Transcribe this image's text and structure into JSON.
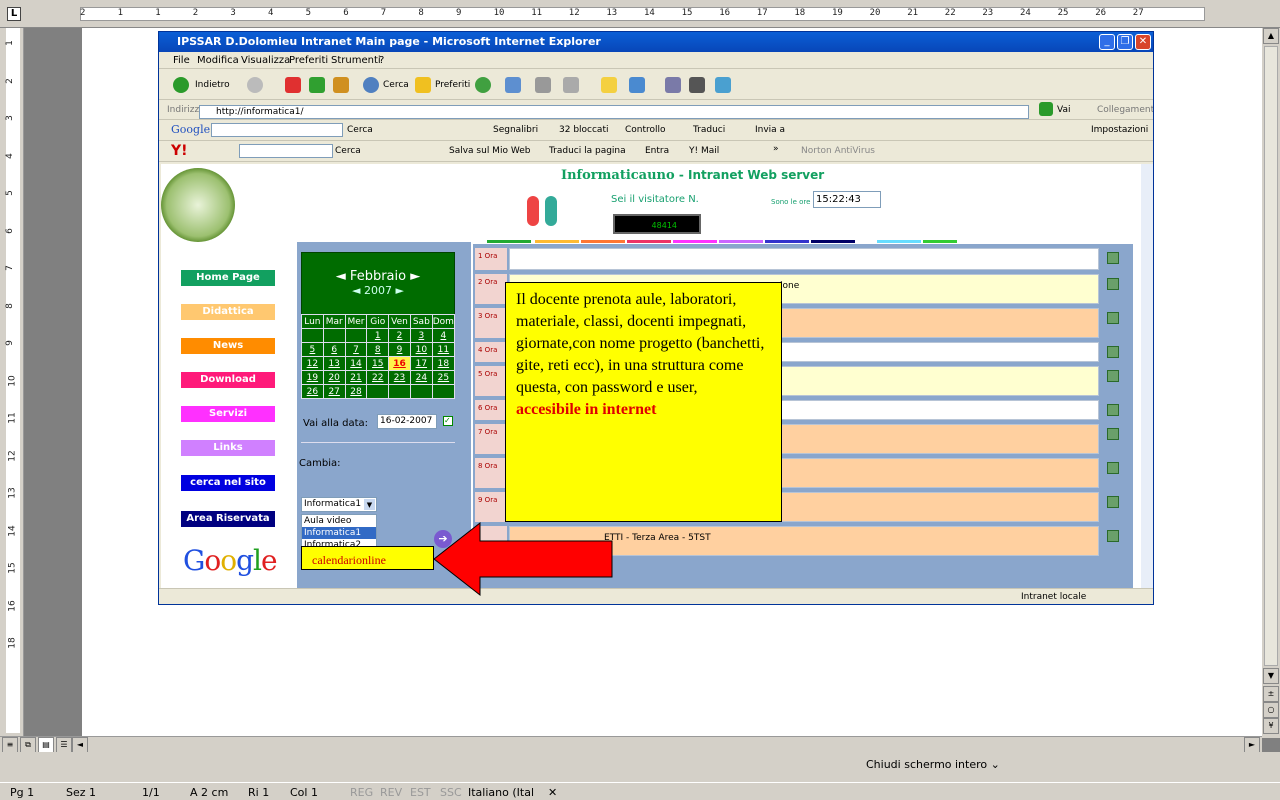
{
  "word": {
    "ruler_corner": "L",
    "ruler_ticks": [
      "2",
      "1",
      "1",
      "2",
      "3",
      "4",
      "5",
      "6",
      "7",
      "8",
      "9",
      "10",
      "11",
      "12",
      "13",
      "14",
      "15",
      "16",
      "17",
      "18",
      "19",
      "20",
      "21",
      "22",
      "23",
      "24",
      "25",
      "26",
      "27"
    ],
    "vruler_ticks": [
      "1",
      "2",
      "3",
      "4",
      "5",
      "6",
      "7",
      "8",
      "9",
      "10",
      "11",
      "12",
      "13",
      "14",
      "15",
      "16",
      "18"
    ],
    "close_fullscreen": "Chiudi schermo intero",
    "status": {
      "pg": "Pg 1",
      "sez": "Sez 1",
      "pages": "1/1",
      "at": "A 2 cm",
      "ri": "Ri 1",
      "col": "Col 1",
      "reg": "REG",
      "rev": "REV",
      "est": "EST",
      "ssc": "SSC",
      "lang": "Italiano (Ital"
    }
  },
  "ie": {
    "title": "IPSSAR D.Dolomieu Intranet Main page - Microsoft Internet Explorer",
    "menu": [
      "File",
      "Modifica",
      "Visualizza",
      "Preferiti",
      "Strumenti",
      "?"
    ],
    "toolbar": {
      "back": "Indietro",
      "search": "Cerca",
      "favorites": "Preferiti"
    },
    "address_label": "Indirizzo",
    "address": "http://informatica1/",
    "go": "Vai",
    "links": "Collegamenti",
    "google_bar": {
      "logo": "Google",
      "search": "Cerca",
      "bookmarks": "Segnalibri",
      "blocked": "32 bloccati",
      "check": "Controllo",
      "translate": "Traduci",
      "send": "Invia a",
      "settings": "Impostazioni"
    },
    "yahoo_bar": {
      "logo": "Y!",
      "search": "Cerca",
      "save": "Salva sul Mio Web",
      "translate": "Traduci la pagina",
      "enter": "Entra",
      "mail": "Y! Mail",
      "norton": "Norton AntiVirus",
      "more": "»"
    },
    "statusbar_zone": "Intranet locale"
  },
  "site": {
    "title": "Informaticauno",
    "subtitle": " - Intranet Web server",
    "visitor_label": "Sei il visitatore N.",
    "counter": "48414",
    "time_label": "Sono le ore",
    "time": "15:22:43",
    "nav": [
      "Home Page",
      "Didattica",
      "News",
      "Download",
      "Servizi",
      "Links",
      "cerca nel sito",
      "Area Riservata"
    ],
    "nav_colors": [
      "#12a060",
      "#ffc870",
      "#ff8c00",
      "#ff1a7a",
      "#ff30ff",
      "#d080ff",
      "#0000e0",
      "#000080"
    ],
    "google": "Google",
    "calendar": {
      "month": "◄ Febbraio ►",
      "year": "◄ 2007 ►",
      "days": [
        "Lun",
        "Mar",
        "Mer",
        "Gio",
        "Ven",
        "Sab",
        "Dom"
      ],
      "weeks": [
        [
          "",
          "",
          "",
          "1",
          "2",
          "3",
          "4"
        ],
        [
          "5",
          "6",
          "7",
          "8",
          "9",
          "10",
          "11"
        ],
        [
          "12",
          "13",
          "14",
          "15",
          "16",
          "17",
          "18"
        ],
        [
          "19",
          "20",
          "21",
          "22",
          "23",
          "24",
          "25"
        ],
        [
          "26",
          "27",
          "28",
          "",
          "",
          "",
          ""
        ]
      ],
      "today": "16"
    },
    "goto_label": "Vai alla data:",
    "goto_value": "16-02-2007",
    "change_label": "Cambia:",
    "select_value": "Informatica1",
    "options": [
      "Aula video",
      "Informatica1",
      "Informatica2"
    ],
    "slots": [
      {
        "label": "1 Ora",
        "text": "",
        "color": "#ffffff"
      },
      {
        "label": "2 Ora",
        "text": "ione",
        "color": "#ffffd0"
      },
      {
        "label": "3 Ora",
        "text": "",
        "color": "#ffd0a0"
      },
      {
        "label": "4 Ora",
        "text": "",
        "color": "#ffffff"
      },
      {
        "label": "5 Ora",
        "text": "",
        "color": "#ffffd0"
      },
      {
        "label": "6 Ora",
        "text": "",
        "color": "#ffffff"
      },
      {
        "label": "7 Ora",
        "text": "",
        "color": "#ffd0a0"
      },
      {
        "label": "8 Ora",
        "text": "",
        "color": "#ffd0a0"
      },
      {
        "label": "9 Ora",
        "text": "",
        "color": "#ffd0a0"
      },
      {
        "label": "",
        "text": "ETTI - Terza Area - 5TST",
        "color": "#ffd0a0"
      }
    ]
  },
  "annotation": {
    "note": "Il docente prenota aule, laboratori, materiale, classi, docenti impegnati, giornate,con nome progetto (banchetti, gite, reti ecc), in una struttura come questa, con password e user,",
    "note_red": "accesibile in internet",
    "callout": "calendarionline"
  }
}
